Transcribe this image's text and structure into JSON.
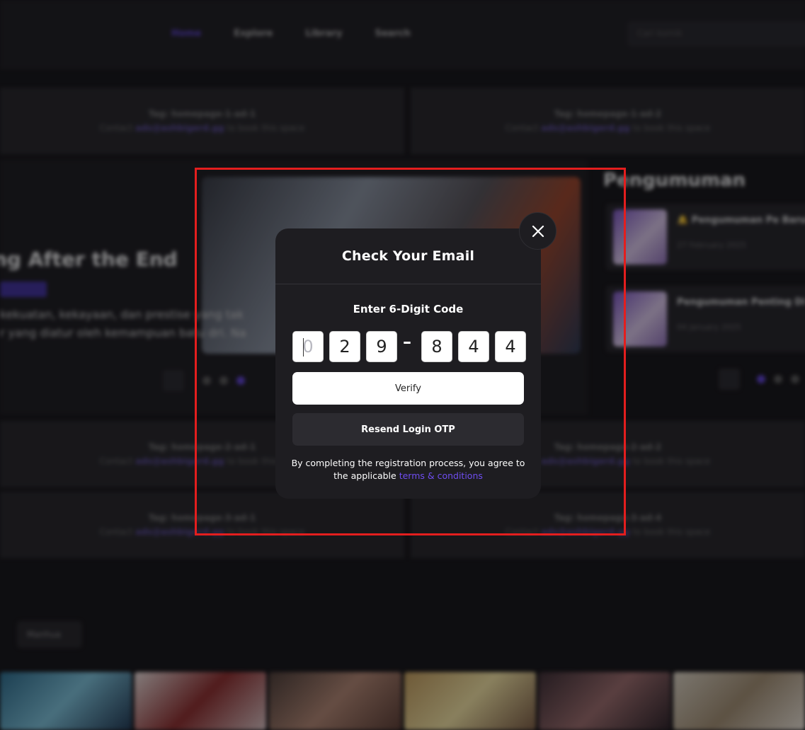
{
  "background": {
    "nav": {
      "items": [
        "Home",
        "Explore",
        "Library",
        "Search"
      ],
      "search_placeholder": "Cari komik"
    },
    "ads": {
      "slot_title_1": "Tag: homepage-1-ad-1",
      "slot_title_2": "Tag: homepage-1-ad-2",
      "slot_title_3": "Tag: homepage-2-ad-1",
      "slot_title_4": "Tag: homepage-2-ad-2",
      "slot_title_5": "Tag: homepage-3-ad-1",
      "slot_title_6": "Tag: homepage-3-ad-4",
      "contact_prefix": "Contact",
      "contact_email": "ads@ashbigerd.gg",
      "contact_suffix": "to book this space"
    },
    "hero": {
      "title": "ng After the End",
      "desc_line1": "kekuatan, kekayaan, dan prestise yang tak",
      "desc_line2": "r yang diatur oleh kemampuan batu dri. Na"
    },
    "announcements": {
      "title": "Pengumuman",
      "item1": "🔔 Pengumuman Pe Baru!",
      "item1_date": "27 February 2025",
      "item2": "Pengumuman Penting Di",
      "item2_date": "04 January 2025"
    },
    "chip_label": "Manhua"
  },
  "modal": {
    "title": "Check Your Email",
    "code_label": "Enter 6-Digit Code",
    "otp_digits": [
      "0",
      "2",
      "9",
      "8",
      "4",
      "4"
    ],
    "separator": "–",
    "verify_label": "Verify",
    "resend_label": "Resend Login OTP",
    "terms_prefix": "By completing the registration process, you agree to the applicable",
    "terms_link": "terms & conditions",
    "close_icon": "close-icon"
  },
  "colors": {
    "accent": "#6f4df0",
    "highlight_border": "#e31e1e",
    "modal_bg": "#1e1d21",
    "page_bg": "#121114"
  }
}
